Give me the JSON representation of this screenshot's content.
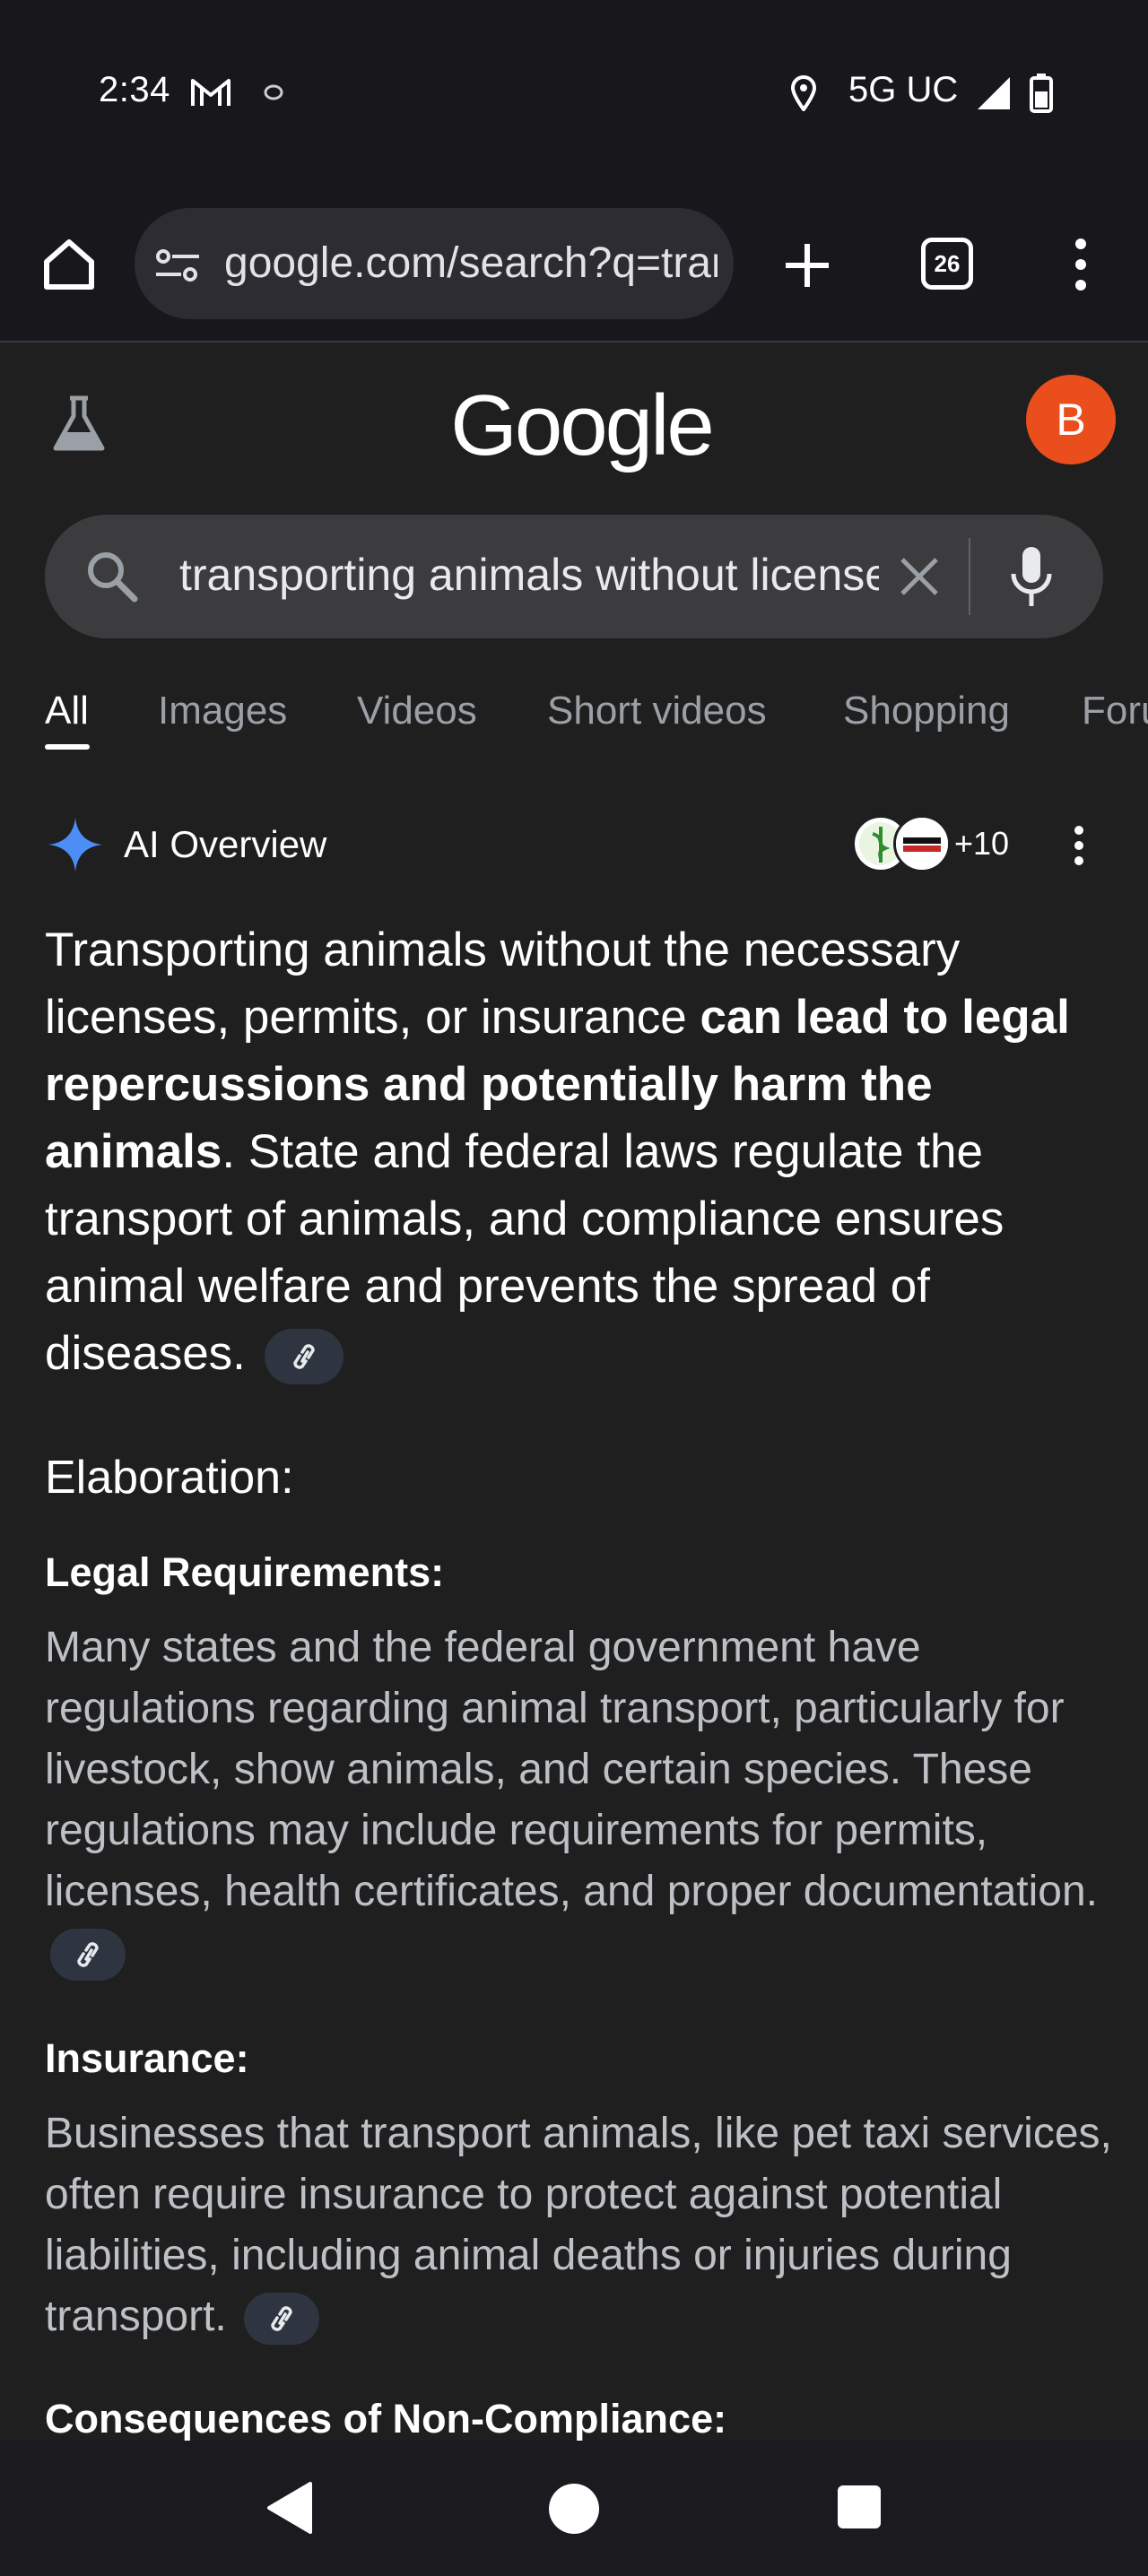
{
  "status_bar": {
    "time": "2:34",
    "network": "5G UC",
    "icons": [
      "gmail-icon",
      "notification-dot-icon",
      "location-icon",
      "signal-icon",
      "battery-icon"
    ]
  },
  "browser": {
    "url": "google.com/search?q=transporting+animals+without+license",
    "tab_count": "26",
    "icons": [
      "home-icon",
      "tune-icon",
      "new-tab-icon",
      "tab-switcher-icon",
      "overflow-menu-icon"
    ]
  },
  "header": {
    "logo": "Google",
    "avatar_letter": "B",
    "avatar_color": "#ea4e1d"
  },
  "search": {
    "query": "transporting animals without license",
    "icons": [
      "search-icon",
      "clear-icon",
      "mic-icon"
    ]
  },
  "tabs": [
    {
      "label": "All",
      "active": true
    },
    {
      "label": "Images",
      "active": false
    },
    {
      "label": "Videos",
      "active": false
    },
    {
      "label": "Short videos",
      "active": false
    },
    {
      "label": "Shopping",
      "active": false
    },
    {
      "label": "Forums",
      "active": false
    }
  ],
  "ai_overview": {
    "title": "AI Overview",
    "sources_more": "+10",
    "intro_plain_1": "Transporting animals without the necessary licenses, permits, or insurance ",
    "intro_bold": "can lead to legal repercussions and potentially harm the animals",
    "intro_plain_2": ". State and federal laws regulate the transport of animals, and compliance ensures animal welfare and prevents the spread of diseases.",
    "elaboration_heading": "Elaboration:",
    "sections": [
      {
        "heading": "Legal Requirements:",
        "text": "Many states and the federal government have regulations regarding animal transport, particularly for livestock, show animals, and certain species. These regulations may include requirements for permits, licenses, health certificates, and proper documentation."
      },
      {
        "heading": "Insurance:",
        "text": "Businesses that transport animals, like pet taxi services, often require insurance to protect against potential liabilities, including animal deaths or injuries during transport."
      },
      {
        "heading": "Consequences of Non-Compliance:",
        "text": ""
      }
    ]
  },
  "colors": {
    "background": "#1f1f1f",
    "toolbar": "#18171c",
    "search_box": "#3c3c3e",
    "link_chip": "#2f3540",
    "accent_spark": "#4c8df6"
  }
}
